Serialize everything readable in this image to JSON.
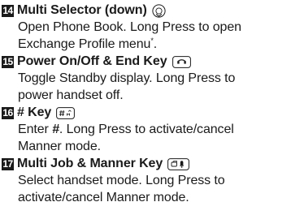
{
  "entries": [
    {
      "number": "14",
      "title": "Multi Selector (down)",
      "icon": "multi-selector-down-icon",
      "lines": [
        "Open Phone Book. Long Press to open",
        "Exchange Profile menu"
      ],
      "footnote_mark": "*",
      "line_end": "."
    },
    {
      "number": "15",
      "title": "Power On/Off & End Key",
      "icon": "power-end-key-icon",
      "lines": [
        "Toggle Standby display. Long Press to",
        "power handset off."
      ]
    },
    {
      "number": "16",
      "title": "# Key",
      "icon": "hash-key-icon",
      "line_prefix": "Enter ",
      "line_emph": "#",
      "line_rest": ". Long Press to activate/cancel",
      "lines": [
        "Manner mode."
      ]
    },
    {
      "number": "17",
      "title": "Multi Job & Manner Key",
      "icon": "multi-job-manner-key-icon",
      "lines": [
        "Select handset mode. Long Press to",
        "activate/cancel Manner mode."
      ]
    }
  ]
}
